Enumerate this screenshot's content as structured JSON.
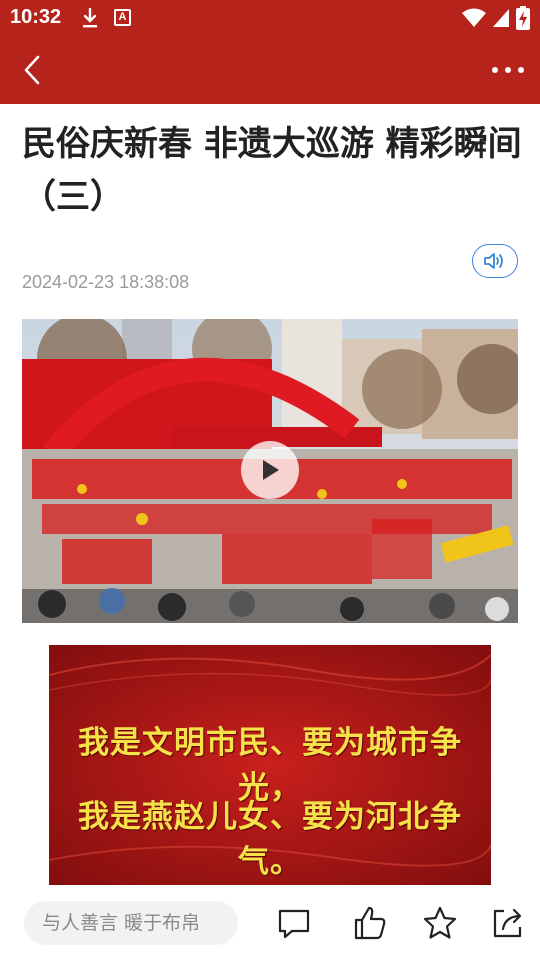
{
  "status_bar": {
    "time": "10:32",
    "icons": [
      "download-icon",
      "a-badge-icon",
      "wifi-icon",
      "signal-icon",
      "battery-charging-icon"
    ],
    "badge_letter": "A"
  },
  "app_bar": {
    "icons": [
      "back-arrow-icon",
      "more-dots-icon"
    ],
    "color": "#b6231b"
  },
  "article": {
    "title": "民俗庆新春 非遗大巡游 精彩瞬间（三）",
    "date": "2024-02-23 18:38:08",
    "audio_icon": "speaker-icon",
    "video_icon": "play-icon"
  },
  "banner": {
    "line1": "我是文明市民、要为城市争光，",
    "line2": "我是燕赵儿女、要为河北争气。"
  },
  "bottom_bar": {
    "comment_placeholder": "与人善言 暖于布帛",
    "icons": [
      "comment-icon",
      "like-icon",
      "star-icon",
      "share-icon"
    ]
  }
}
